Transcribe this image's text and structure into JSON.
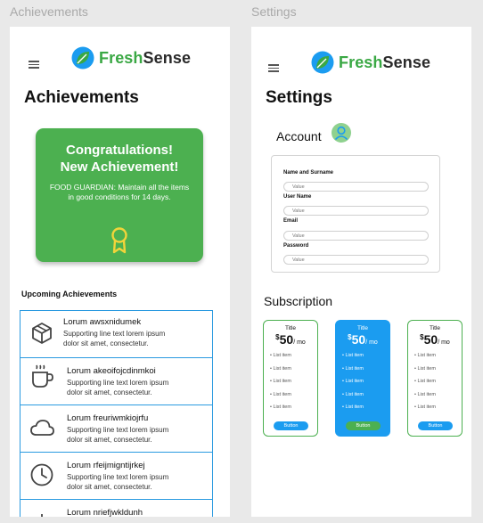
{
  "frames": {
    "achievements_label": "Achievements",
    "settings_label": "Settings"
  },
  "brand": {
    "fresh": "Fresh",
    "sense": "Sense",
    "green": "#3aa844",
    "blue": "#1b9cf0"
  },
  "achievements_page": {
    "title": "Achievements",
    "congrats": {
      "title_line1": "Congratulations!",
      "title_line2": "New Achievement!",
      "description": "FOOD GUARDIAN: Maintain all the items in good conditions for 14 days.",
      "icon": "medal-icon"
    },
    "upcoming_label": "Upcoming Achievements",
    "items": [
      {
        "icon": "cube-icon",
        "title": "Lorum awsxnidumek",
        "sub1": "Supporting line text lorem ipsum",
        "sub2": "dolor sit amet, consectetur."
      },
      {
        "icon": "mug-icon",
        "title": "Lorum akeoifojcdinmkoi",
        "sub1": "Supporting line text lorem ipsum",
        "sub2": "dolor sit amet, consectetur."
      },
      {
        "icon": "cloud-icon",
        "title": "Lorum freuriwmkiojrfu",
        "sub1": "Supporting line text lorem ipsum",
        "sub2": "dolor sit amet, consectetur."
      },
      {
        "icon": "clock-icon",
        "title": "Lorum rfeijmigntijrkej",
        "sub1": "Supporting line text lorem ipsum",
        "sub2": "dolor sit amet, consectetur."
      },
      {
        "icon": "plus-icon",
        "title": "Lorum nriefjwkldunh",
        "sub1": "",
        "sub2": ""
      }
    ]
  },
  "settings_page": {
    "title": "Settings",
    "account_label": "Account",
    "form": {
      "fields": [
        {
          "label": "Name and Surname",
          "placeholder": "Value"
        },
        {
          "label": "User Name",
          "placeholder": "Value"
        },
        {
          "label": "Email",
          "placeholder": "Value"
        },
        {
          "label": "Password",
          "placeholder": "Value"
        }
      ]
    },
    "subscription_label": "Subscription",
    "plans": [
      {
        "title": "Title",
        "currency": "$",
        "price": "50",
        "period": "/ mo",
        "items": [
          "List item",
          "List item",
          "List item",
          "List item",
          "List item"
        ],
        "button": "Button"
      },
      {
        "title": "Title",
        "currency": "$",
        "price": "50",
        "period": "/ mo",
        "items": [
          "List item",
          "List item",
          "List item",
          "List item",
          "List item"
        ],
        "button": "Button"
      },
      {
        "title": "Title",
        "currency": "$",
        "price": "50",
        "period": "/ mo",
        "items": [
          "List item",
          "List item",
          "List item",
          "List item",
          "List item"
        ],
        "button": "Button"
      }
    ]
  }
}
